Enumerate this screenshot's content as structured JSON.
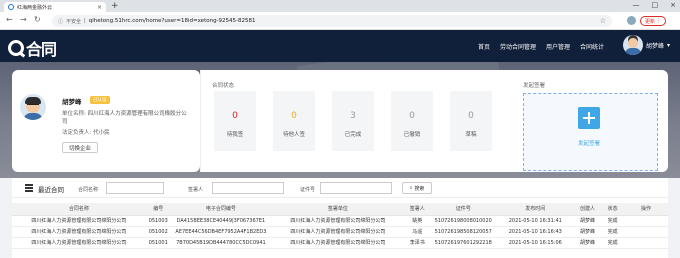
{
  "browser": {
    "tab_title": "红海两金融外云",
    "new_tab": "+",
    "security": "不安全",
    "url": "qihetong.51hrc.com/home?user=18id=xetong-92545-82581",
    "update_label": "更新"
  },
  "app": {
    "logo_text": "合同",
    "nav": [
      "首页",
      "劳动合同管理",
      "用户管理",
      "合同统计"
    ],
    "user_name": "胡梦峰"
  },
  "profile": {
    "name": "胡梦峰",
    "badge": "已认证",
    "unit_label": "单位名称:",
    "unit_value": "四川红海人力资源管理有限公司橡胶分公司",
    "legal_label": "法定负责人:",
    "legal_value": "代小民",
    "switch_button": "切换企业"
  },
  "status": {
    "title": "合同状态",
    "items": [
      {
        "num": "0",
        "label": "待我签",
        "color": "#e02020"
      },
      {
        "num": "0",
        "label": "待他人签",
        "color": "#f5a623"
      },
      {
        "num": "3",
        "label": "已完成",
        "color": "#999999"
      },
      {
        "num": "0",
        "label": "已撤销",
        "color": "#999999"
      },
      {
        "num": "0",
        "label": "草稿",
        "color": "#999999"
      }
    ]
  },
  "launch": {
    "title": "发起签署",
    "button": "发起签署"
  },
  "recent": {
    "title": "最近合同",
    "filter_name": "合同名称",
    "filter_signer": "签署人",
    "filter_id": "证件号",
    "search": "搜索",
    "columns": [
      "合同名称",
      "编号",
      "电子合同编号",
      "签署单位",
      "签署人",
      "证件号",
      "发布时间",
      "创建人",
      "状态",
      "操作"
    ],
    "rows": [
      [
        "四川红海人力资源管理有限公司绵阳分公司",
        "051003",
        "DA415BEE38CE40449|3F067367E1",
        "四川红海人力资源管理有限公司绵阳分公司",
        "姚英",
        "510726198008010020",
        "2021-05-10 16:31:41",
        "胡梦峰",
        "完成",
        ""
      ],
      [
        "四川红海人力资源管理有限公司绵阳分公司",
        "051002",
        "AE7EE44C56DB4EF7952A4F1B2ED3",
        "四川红海人力资源管理有限公司绵阳分公司",
        "马遥",
        "510726198508120057",
        "2021-05-10 16:16:43",
        "胡梦峰",
        "完成",
        ""
      ],
      [
        "四川红海人力资源管理有限公司绵阳分公司",
        "051001",
        "7B70D45B19DB444780CC5DC0941",
        "四川红海人力资源管理有限公司绵阳分公司",
        "李泽书",
        "510726197601292218",
        "2021-05-10 16:15:06",
        "胡梦峰",
        "完成",
        ""
      ]
    ]
  }
}
